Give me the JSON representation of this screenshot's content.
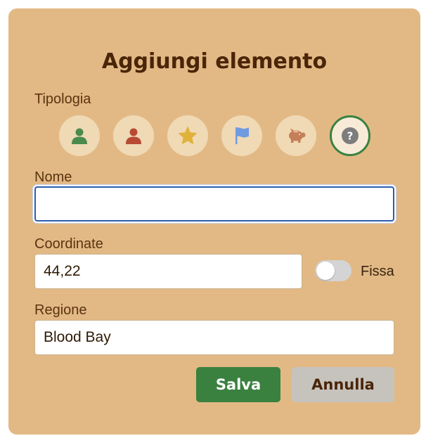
{
  "dialog": {
    "title": "Aggiungi elemento"
  },
  "type": {
    "label": "Tipologia",
    "options": [
      {
        "icon": "person-green-icon",
        "color": "#4a8a4e"
      },
      {
        "icon": "person-red-icon",
        "color": "#b84a34"
      },
      {
        "icon": "star-icon",
        "color": "#e0b23a"
      },
      {
        "icon": "flag-icon",
        "color": "#6f9be0"
      },
      {
        "icon": "piggy-bank-icon",
        "color": "#c47f58"
      },
      {
        "icon": "question-icon",
        "color": "#7d7d7d"
      }
    ],
    "selected_index": 5
  },
  "name": {
    "label": "Nome",
    "value": ""
  },
  "coordinates": {
    "label": "Coordinate",
    "value": "44,22",
    "fixed_label": "Fissa",
    "fixed": false
  },
  "region": {
    "label": "Regione",
    "value": "Blood Bay"
  },
  "actions": {
    "save_label": "Salva",
    "cancel_label": "Annulla"
  },
  "colors": {
    "dialog_bg": "#e2b985",
    "accent_green": "#3a8140",
    "focus_blue": "#2a5db0"
  }
}
